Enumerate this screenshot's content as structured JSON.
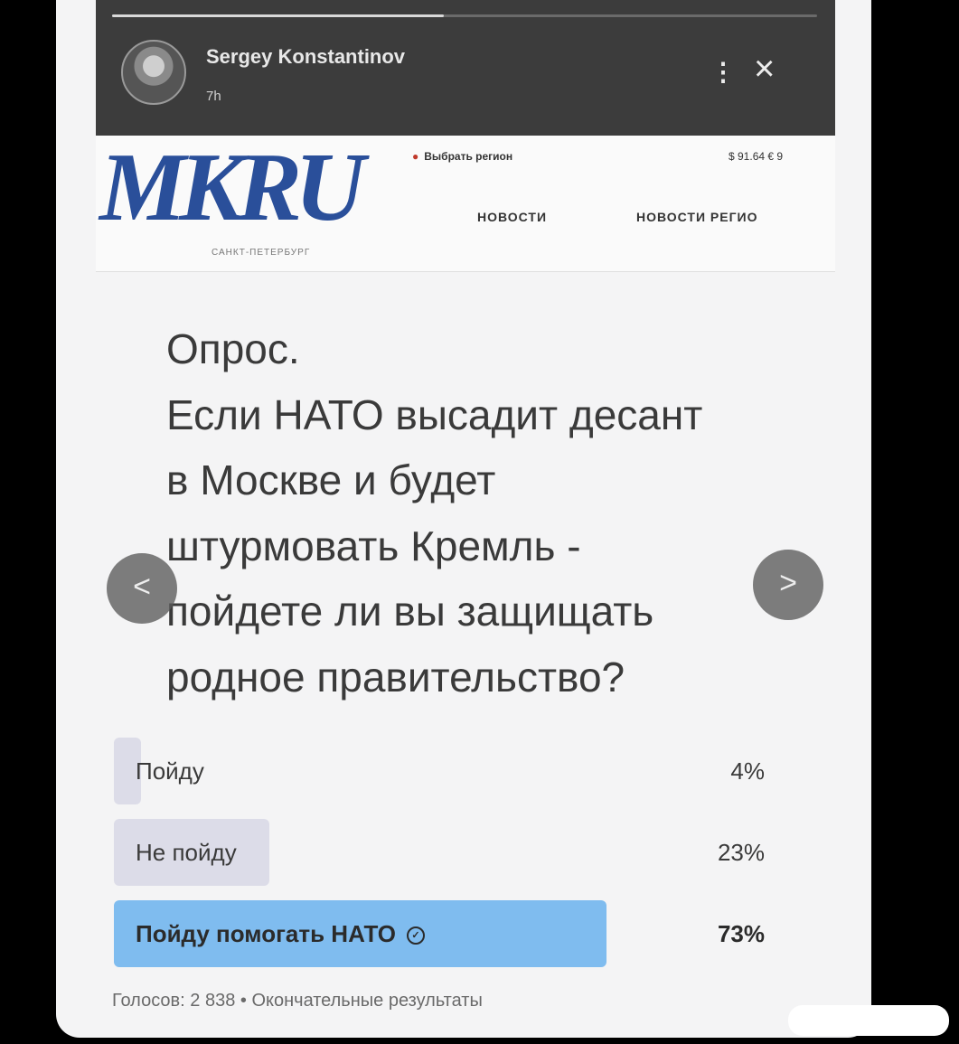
{
  "story": {
    "username": "Sergey Konstantinov",
    "time_ago": "7h",
    "progress": 0.47,
    "more_icon": "more-vertical-icon",
    "close_icon": "close-icon"
  },
  "site": {
    "logo": "MKRU",
    "logo_sub": "САНКТ-ПЕТЕРБУРГ",
    "region": "Выбрать регион",
    "currency": "$ 91.64  € 9",
    "nav": [
      "НОВОСТИ",
      "НОВОСТИ РЕГИО"
    ]
  },
  "poll": {
    "question_lines": [
      "Опрос.",
      "Если НАТО высадит десант",
      "в Москве и будет",
      "штурмовать Кремль -",
      "пойдете ли вы защищать",
      "родное правительство?"
    ],
    "options": [
      {
        "label": "Пойду",
        "percent": "4%",
        "share": 0.04
      },
      {
        "label": "Не пойду",
        "percent": "23%",
        "share": 0.23
      },
      {
        "label": "Пойду помогать НАТО",
        "percent": "73%",
        "share": 0.73,
        "selected": true
      }
    ],
    "footer": "Голосов: 2 838 • Окончательные результаты"
  },
  "colors": {
    "selected_bar": "#7fbcef",
    "bar": "#dcdce8",
    "logo": "#2a4f9a"
  },
  "icons": {
    "prev": "chevron-left-icon",
    "next": "chevron-right-icon",
    "selected": "check-circle-icon"
  }
}
